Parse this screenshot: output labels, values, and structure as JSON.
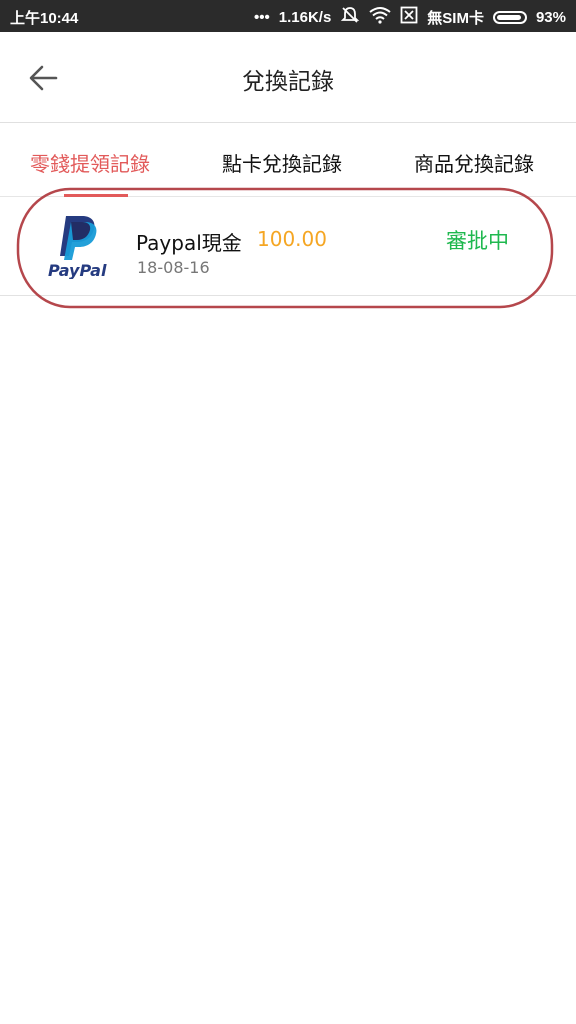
{
  "status_bar": {
    "time": "上午10:44",
    "dots": "•••",
    "speed": "1.16K/s",
    "mute_icon": "bell-off-icon",
    "wifi_icon": "wifi-icon",
    "sim_icon": "sim-x-icon",
    "carrier": "無SIM卡",
    "battery": "93%"
  },
  "header": {
    "back_icon": "arrow-left-icon",
    "title": "兌換記錄"
  },
  "tabs": [
    {
      "label": "零錢提領記錄",
      "active": true
    },
    {
      "label": "點卡兌換記錄",
      "active": false
    },
    {
      "label": "商品兌換記錄",
      "active": false
    }
  ],
  "records": [
    {
      "logo": "paypal-logo",
      "logo_text": "PayPal",
      "title": "Paypal現金",
      "amount": "100.00",
      "date": "18-08-16",
      "status": "審批中"
    }
  ],
  "colors": {
    "accent": "#e25a5a",
    "amount": "#f5a623",
    "status_ok": "#1fb84f",
    "status_bar_bg": "#2b2b2b",
    "highlight_ring": "#b5474c",
    "paypal_dark": "#253b80",
    "paypal_light": "#179bd7"
  }
}
